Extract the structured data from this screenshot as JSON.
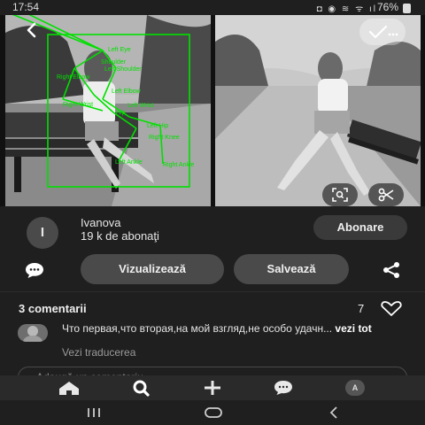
{
  "statusbar": {
    "time": "17:54",
    "icons": "◘ ◉ ≋ ᯤ ıl",
    "battery": "76%"
  },
  "hero": {
    "pose_labels": {
      "left_eye": "Left Eye",
      "shoulder": "Shoulder",
      "left_shoulder": "Left Shoulder",
      "right_elbow": "Right Elbow",
      "left_elbow": "Left Elbow",
      "right_wrist": "Right Wrist",
      "left_wrist": "Left Wrist",
      "hip": "Hip",
      "left_hip": "Left Hip",
      "right_knee": "Right Knee",
      "left_ankle": "Left Ankle",
      "right_ankle": "Right Ankle"
    },
    "accent": "#00e000",
    "icons": {
      "back": "chevron-left-icon",
      "select": "check-dots-icon",
      "lens": "visual-search-icon",
      "cut": "scissors-icon"
    }
  },
  "author": {
    "initial": "I",
    "name": "Ivanova",
    "followers": "19 k de abonaţi",
    "follow_label": "Abonare"
  },
  "actions": {
    "view_label": "Vizualizează",
    "save_label": "Salvează"
  },
  "comments": {
    "header": "3 comentarii",
    "like_count": "7",
    "first": {
      "text": "Что первая,что вторая,на мой взгляд,не особо удачн... ",
      "more": "vezi tot",
      "translate": "Vezi traducerea"
    },
    "reply_placeholder": "Adaugă un comentariu"
  },
  "tabs": {
    "profile_initial": "A"
  }
}
